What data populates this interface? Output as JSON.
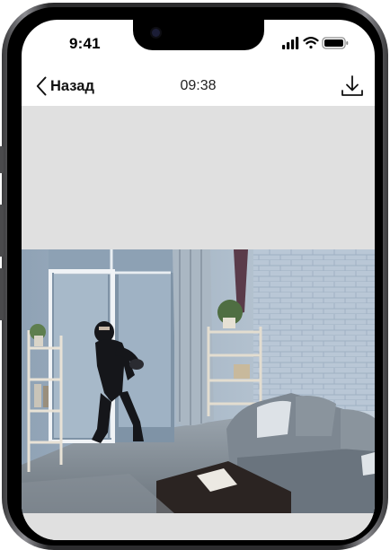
{
  "status_bar": {
    "time": "9:41",
    "icons": [
      "signal-icon",
      "wifi-icon",
      "battery-icon"
    ]
  },
  "nav": {
    "back_label": "Назад",
    "title_time": "09:38",
    "download_icon": "download-icon"
  },
  "colors": {
    "background": "#e0e0e0",
    "text": "#111111"
  }
}
